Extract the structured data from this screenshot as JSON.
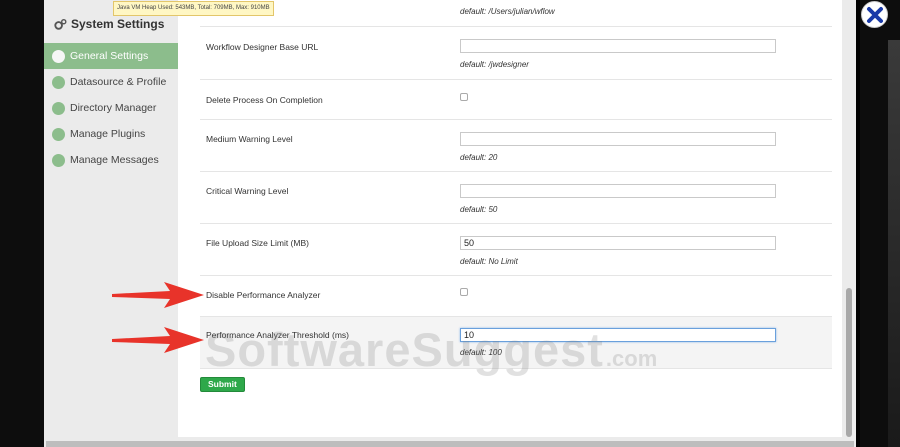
{
  "heap_status": "Java VM Heap Used: 543MB, Total: 709MB, Max: 910MB",
  "sidebar": {
    "title": "System Settings",
    "items": [
      {
        "label": "General Settings",
        "active": true
      },
      {
        "label": "Datasource & Profile",
        "active": false
      },
      {
        "label": "Directory Manager",
        "active": false
      },
      {
        "label": "Manage Plugins",
        "active": false
      },
      {
        "label": "Manage Messages",
        "active": false
      }
    ]
  },
  "settings": {
    "base_dir_default": "default: /Users/julian/wflow",
    "designer_url": {
      "label": "Workflow Designer Base URL",
      "value": "",
      "default": "default: /jwdesigner"
    },
    "delete_process": {
      "label": "Delete Process On Completion",
      "checked": false
    },
    "medium_warning": {
      "label": "Medium Warning Level",
      "value": "",
      "default": "default: 20"
    },
    "critical_warning": {
      "label": "Critical Warning Level",
      "value": "",
      "default": "default: 50"
    },
    "upload_limit": {
      "label": "File Upload Size Limit (MB)",
      "value": "50",
      "default": "default: No Limit"
    },
    "disable_analyzer": {
      "label": "Disable Performance Analyzer",
      "checked": false
    },
    "analyzer_threshold": {
      "label": "Performance Analyzer Threshold (ms)",
      "value": "10",
      "default": "default: 100"
    }
  },
  "submit_label": "Submit",
  "watermark": {
    "main": "SoftwareSuggest",
    "tld": ".com"
  },
  "icons": {
    "sidebar_title": "gears-icon",
    "close": "close-icon",
    "annotation": "red-arrow-icon"
  },
  "colors": {
    "accent_green": "#8cbd8c",
    "submit_green": "#2ea84a",
    "close_blue": "#1a3aa8",
    "arrow_red": "#e8332a"
  }
}
